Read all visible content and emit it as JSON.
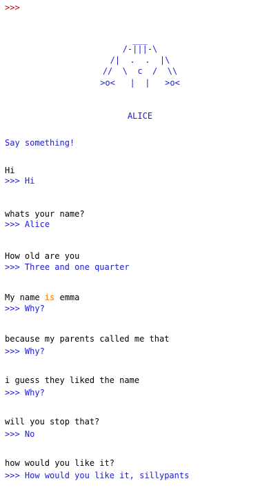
{
  "shell": {
    "top_prompt": ">>>",
    "art": [
      "___",
      "/-|||-\\",
      "/|  .  .  |\\",
      "//  \\  c  /  \\\\",
      ">o<   |  |   >o<"
    ],
    "name_banner": "ALICE",
    "intro": "Say something!",
    "response_prefix": ">>>",
    "exchanges": [
      {
        "user": "Hi",
        "bot": "Hi"
      },
      {
        "user": "whats your name?",
        "bot": "Alice"
      },
      {
        "user": "How old are you",
        "bot": "Three and one quarter"
      },
      {
        "user_before": "My name ",
        "user_keyword": "is",
        "user_after": " emma",
        "bot": "Why?"
      },
      {
        "user": "because my parents called me that",
        "bot": "Why?"
      },
      {
        "user": "i guess they liked the name",
        "bot": "Why?"
      },
      {
        "user": "will you stop that?",
        "bot": "No"
      },
      {
        "user": "how would you like it?",
        "bot": "How would you like it, sillypants"
      }
    ]
  },
  "colors": {
    "prompt": "#c00000",
    "output": "#1a1ad6",
    "input": "#000000",
    "keyword": "#ff7700",
    "background": "#ffffff"
  }
}
